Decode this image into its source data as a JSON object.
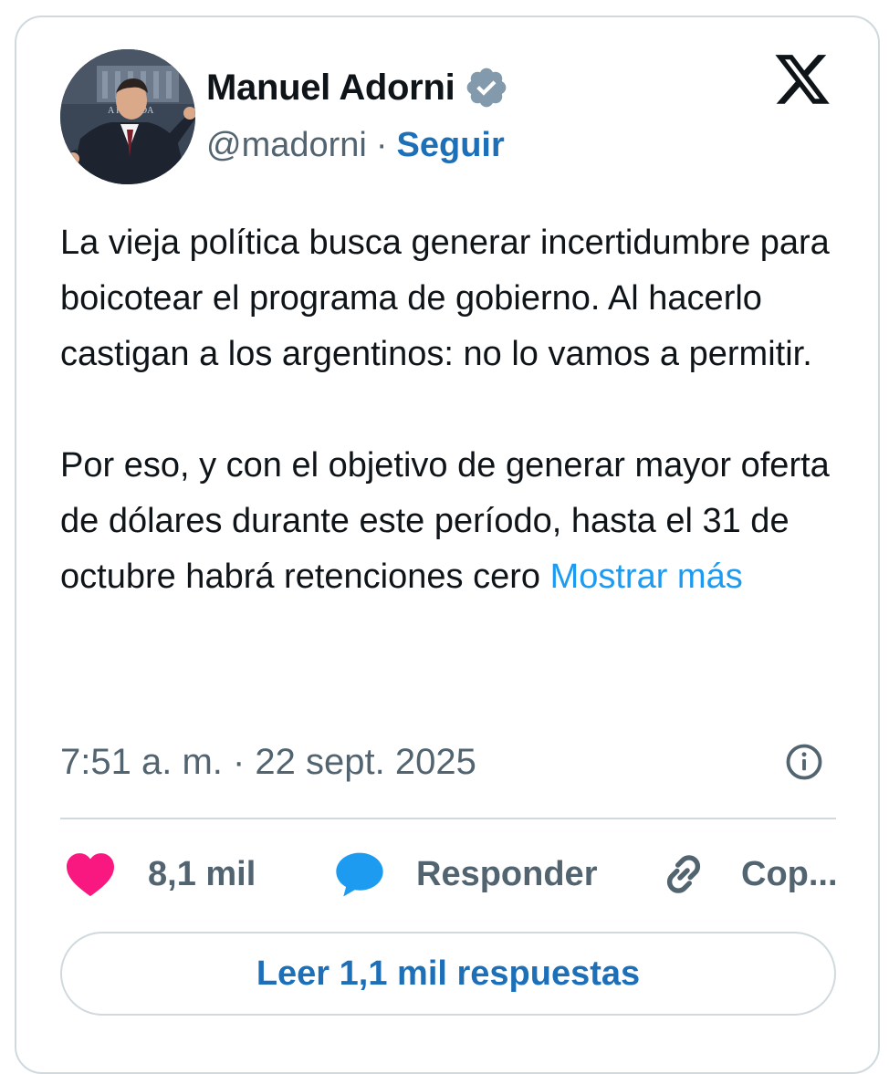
{
  "author": {
    "display_name": "Manuel Adorni",
    "handle": "@madorni",
    "separator": "·",
    "follow_label": "Seguir",
    "avatar_caption": "A ROSADA",
    "verified": true
  },
  "brand": {
    "logo": "x-logo-icon"
  },
  "post": {
    "paragraphs": [
      "La vieja política busca generar incertidumbre para boicotear el programa de gobierno. Al hacerlo castigan a los argentinos: no lo vamos a permitir.",
      "Por eso, y con el objetivo de generar mayor oferta de dólares durante este período, hasta el 31 de octubre habrá retenciones cero"
    ],
    "show_more_label": "Mostrar más",
    "timestamp": "7:51 a. m. · 22 sept. 2025"
  },
  "actions": {
    "like_count": "8,1 mil",
    "reply_label": "Responder",
    "copy_label": "Cop..."
  },
  "footer": {
    "read_replies_label": "Leer 1,1 mil respuestas"
  },
  "colors": {
    "like": "#f91880",
    "reply": "#1d9bf0",
    "link": "#1d70b8",
    "show_more": "#1d9bf0",
    "muted": "#536471",
    "border": "#cfd9de",
    "verified_badge": "#829aab"
  }
}
